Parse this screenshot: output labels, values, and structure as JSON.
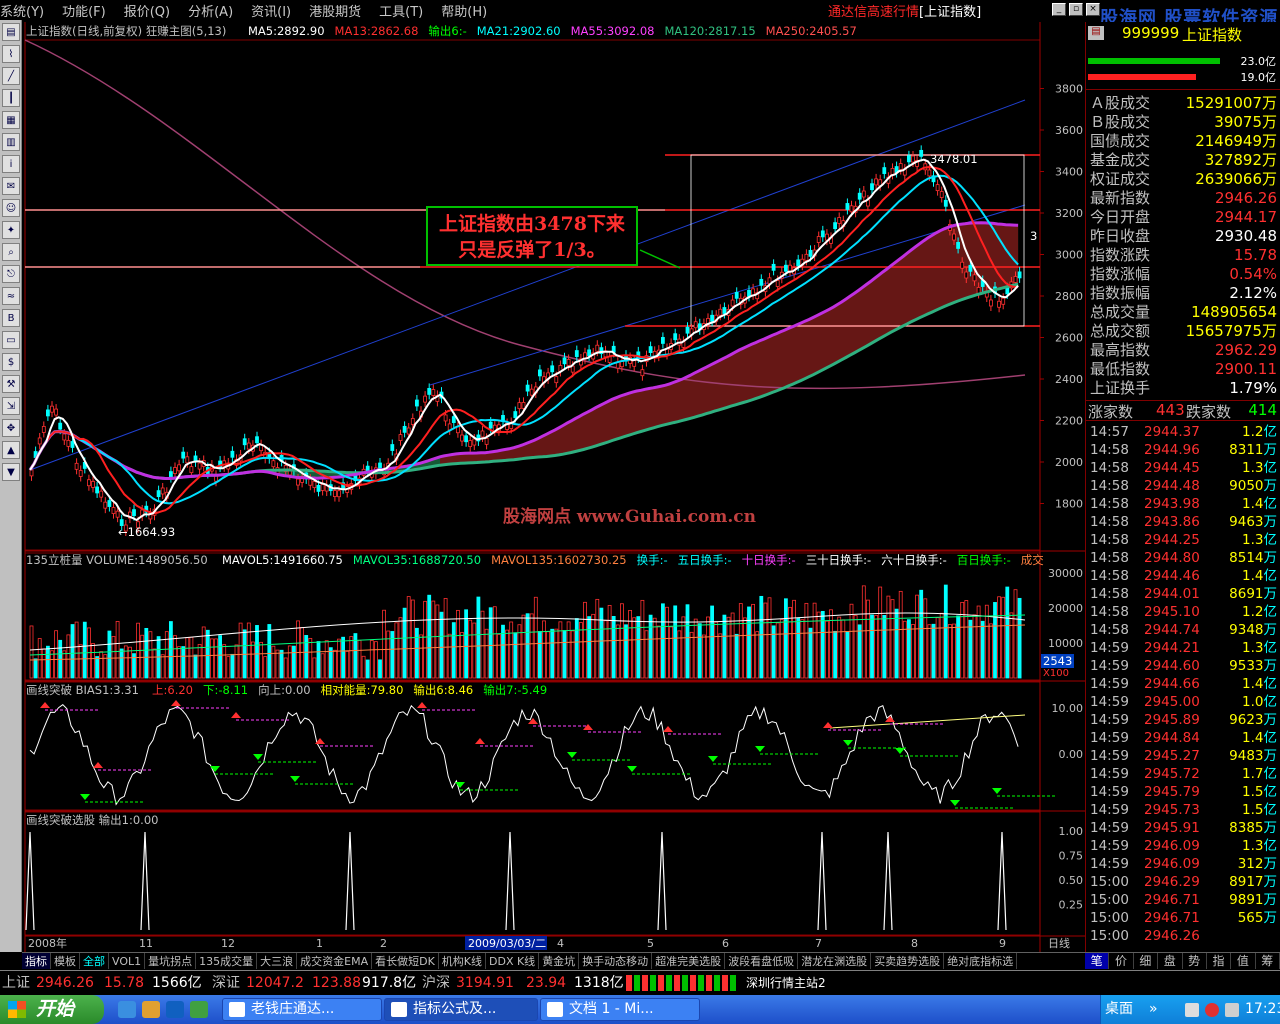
{
  "menu": [
    "系统(Y)",
    "功能(F)",
    "报价(Q)",
    "分析(A)",
    "资讯(I)",
    "港股期货",
    "工具(T)",
    "帮助(H)"
  ],
  "app_title": "通达信高速行情",
  "app_title_sub": "[上证指数]",
  "watermark": "股海网  股票软件资源分享",
  "main_chart": {
    "title": "上证指数(日线,前复权) 狂赚主图(5,13)",
    "ma": [
      {
        "label": "MA5:2892.90",
        "color": "#ffffff"
      },
      {
        "label": "MA13:2862.68",
        "color": "#ff3030"
      },
      {
        "label": "输出6:-",
        "color": "#00ff00"
      },
      {
        "label": "MA21:2902.60",
        "color": "#00ffff"
      },
      {
        "label": "MA55:3092.08",
        "color": "#ff40ff"
      },
      {
        "label": "MA120:2817.15",
        "color": "#30c080"
      },
      {
        "label": "MA250:2405.57",
        "color": "#ff5050"
      }
    ],
    "y_ticks": [
      3800,
      3600,
      3400,
      3200,
      3000,
      2800,
      2600,
      2400,
      2200,
      2000,
      1800
    ],
    "high_label": "3478.01",
    "low_label": "←1664.93",
    "annotation_line1": "上证指数由3478下来",
    "annotation_line2": "只是反弹了1/3。",
    "watermark_text": "股海网点  www.Guhai.com.cn",
    "side_mark": "3"
  },
  "volume_chart": {
    "title": "135立桩量 VOLUME:1489056.50",
    "ma": [
      {
        "label": "MAVOL5:1491660.75",
        "color": "#ffffff"
      },
      {
        "label": "MAVOL35:1688720.50",
        "color": "#00ff80"
      },
      {
        "label": "MAVOL135:1602730.25",
        "color": "#ff8040"
      }
    ],
    "extra": [
      {
        "label": "换手:-",
        "color": "#00ffff"
      },
      {
        "label": "五日换手:-",
        "color": "#00ffff"
      },
      {
        "label": "十日换手:-",
        "color": "#ff40ff"
      },
      {
        "label": "三十日换手:-",
        "color": "#ffffff"
      },
      {
        "label": "六十日换手:-",
        "color": "#ffffff"
      },
      {
        "label": "百日换手:-",
        "color": "#00ff00"
      },
      {
        "label": "成交",
        "color": "#ff8040"
      }
    ],
    "y_ticks": [
      "30000",
      "20000",
      "10000"
    ],
    "unit": "X100",
    "badge": "2543"
  },
  "bias_chart": {
    "title": "画线突破 BIAS1:3.31",
    "items": [
      {
        "label": "上:6.20",
        "color": "#ff3030"
      },
      {
        "label": "下:-8.11",
        "color": "#00ff00"
      },
      {
        "label": "向上:0.00",
        "color": "#c0c0c0"
      },
      {
        "label": "相对能量:79.80",
        "color": "#ffff00"
      },
      {
        "label": "输出6:8.46",
        "color": "#ffff00"
      },
      {
        "label": "输出7:-5.49",
        "color": "#00ff00"
      }
    ],
    "y_ticks": [
      "10.00",
      "0.00"
    ]
  },
  "signal_chart": {
    "title": "画线突破选股 输出1:0.00",
    "y_ticks": [
      "1.00",
      "0.75",
      "0.50",
      "0.25"
    ]
  },
  "x_axis": {
    "labels": [
      "2008年",
      "11",
      "12",
      "1",
      "2",
      "2009/03/03/二",
      "4",
      "5",
      "6",
      "7",
      "8",
      "9"
    ],
    "period": "日线"
  },
  "right_panel": {
    "code": "999999",
    "name": "上证指数",
    "bars": [
      {
        "value": "23.0亿",
        "color": "#00c000"
      },
      {
        "value": "19.0亿",
        "color": "#ff2020"
      }
    ],
    "stats": [
      {
        "label": "Ａ股成交",
        "value": "15291007万",
        "color": "#ffff00"
      },
      {
        "label": "Ｂ股成交",
        "value": "39075万",
        "color": "#ffff00"
      },
      {
        "label": "国债成交",
        "value": "2146949万",
        "color": "#ffff00"
      },
      {
        "label": "基金成交",
        "value": "327892万",
        "color": "#ffff00"
      },
      {
        "label": "权证成交",
        "value": "2639066万",
        "color": "#ffff00"
      },
      {
        "label": "最新指数",
        "value": "2946.26",
        "color": "#ff3030"
      },
      {
        "label": "今日开盘",
        "value": "2944.17",
        "color": "#ff3030"
      },
      {
        "label": "昨日收盘",
        "value": "2930.48",
        "color": "#ffffff"
      },
      {
        "label": "指数涨跌",
        "value": "15.78",
        "color": "#ff3030"
      },
      {
        "label": "指数涨幅",
        "value": "0.54%",
        "color": "#ff3030"
      },
      {
        "label": "指数振幅",
        "value": "2.12%",
        "color": "#ffffff"
      },
      {
        "label": "总成交量",
        "value": "148905654",
        "color": "#ffff00"
      },
      {
        "label": "总成交额",
        "value": "15657975万",
        "color": "#ffff00"
      },
      {
        "label": "最高指数",
        "value": "2962.29",
        "color": "#ff3030"
      },
      {
        "label": "最低指数",
        "value": "2900.11",
        "color": "#ff3030"
      },
      {
        "label": "上证换手",
        "value": "1.79%",
        "color": "#ffffff"
      }
    ],
    "up_label": "涨家数",
    "up_value": "443",
    "down_label": "跌家数",
    "down_value": "414",
    "ticks": [
      {
        "t": "14:57",
        "p": "2944.37",
        "v": "1.2",
        "u": "亿"
      },
      {
        "t": "14:58",
        "p": "2944.96",
        "v": "8311",
        "u": "万"
      },
      {
        "t": "14:58",
        "p": "2944.45",
        "v": "1.3",
        "u": "亿"
      },
      {
        "t": "14:58",
        "p": "2944.48",
        "v": "9050",
        "u": "万"
      },
      {
        "t": "14:58",
        "p": "2943.98",
        "v": "1.4",
        "u": "亿"
      },
      {
        "t": "14:58",
        "p": "2943.86",
        "v": "9463",
        "u": "万"
      },
      {
        "t": "14:58",
        "p": "2944.25",
        "v": "1.3",
        "u": "亿"
      },
      {
        "t": "14:58",
        "p": "2944.80",
        "v": "8514",
        "u": "万"
      },
      {
        "t": "14:58",
        "p": "2944.46",
        "v": "1.4",
        "u": "亿"
      },
      {
        "t": "14:58",
        "p": "2944.01",
        "v": "8691",
        "u": "万"
      },
      {
        "t": "14:58",
        "p": "2945.10",
        "v": "1.2",
        "u": "亿"
      },
      {
        "t": "14:58",
        "p": "2944.74",
        "v": "9348",
        "u": "万"
      },
      {
        "t": "14:59",
        "p": "2944.21",
        "v": "1.3",
        "u": "亿"
      },
      {
        "t": "14:59",
        "p": "2944.60",
        "v": "9533",
        "u": "万"
      },
      {
        "t": "14:59",
        "p": "2944.66",
        "v": "1.4",
        "u": "亿"
      },
      {
        "t": "14:59",
        "p": "2945.00",
        "v": "1.0",
        "u": "亿"
      },
      {
        "t": "14:59",
        "p": "2945.89",
        "v": "9623",
        "u": "万"
      },
      {
        "t": "14:59",
        "p": "2944.84",
        "v": "1.4",
        "u": "亿"
      },
      {
        "t": "14:59",
        "p": "2945.27",
        "v": "9483",
        "u": "万"
      },
      {
        "t": "14:59",
        "p": "2945.72",
        "v": "1.7",
        "u": "亿"
      },
      {
        "t": "14:59",
        "p": "2945.79",
        "v": "1.5",
        "u": "亿"
      },
      {
        "t": "14:59",
        "p": "2945.73",
        "v": "1.5",
        "u": "亿"
      },
      {
        "t": "14:59",
        "p": "2945.91",
        "v": "8385",
        "u": "万"
      },
      {
        "t": "14:59",
        "p": "2946.09",
        "v": "1.3",
        "u": "亿"
      },
      {
        "t": "14:59",
        "p": "2946.09",
        "v": "312",
        "u": "万"
      },
      {
        "t": "15:00",
        "p": "2946.29",
        "v": "8917",
        "u": "万"
      },
      {
        "t": "15:00",
        "p": "2946.71",
        "v": "9891",
        "u": "万"
      },
      {
        "t": "15:00",
        "p": "2946.71",
        "v": "565",
        "u": "万"
      },
      {
        "t": "15:00",
        "p": "2946.26",
        "v": "",
        "u": ""
      }
    ]
  },
  "bottom_tabs": [
    "指标",
    "模板",
    "全部",
    "VOL1",
    "量坑拐点",
    "135成交量",
    "大三浪",
    "成交资金EMA",
    "看长做短DK",
    "机构K线",
    "DDX K线",
    "黄金坑",
    "换手动态移动",
    "超准完美选股",
    "波段看盘低吸",
    "潜龙在渊选股",
    "买卖趋势选股",
    "绝对底指标选"
  ],
  "right_tabs": [
    "笔",
    "价",
    "细",
    "盘",
    "势",
    "指",
    "值",
    "筹"
  ],
  "status": [
    {
      "label": "上证",
      "value": "2946.26",
      "chg": "15.78",
      "vol": "1566亿"
    },
    {
      "label": "深证",
      "value": "12047.2",
      "chg": "123.88",
      "vol": "917.8亿"
    },
    {
      "label": "沪深",
      "value": "3194.91",
      "chg": "23.94",
      "vol": "1318亿"
    }
  ],
  "server": "深圳行情主站2",
  "taskbar": {
    "start": "开始",
    "tasks": [
      "老钱庄通达...",
      "指标公式及...",
      "文档 1 - Mi..."
    ],
    "desktop": "桌面",
    "clock": "17:23"
  }
}
